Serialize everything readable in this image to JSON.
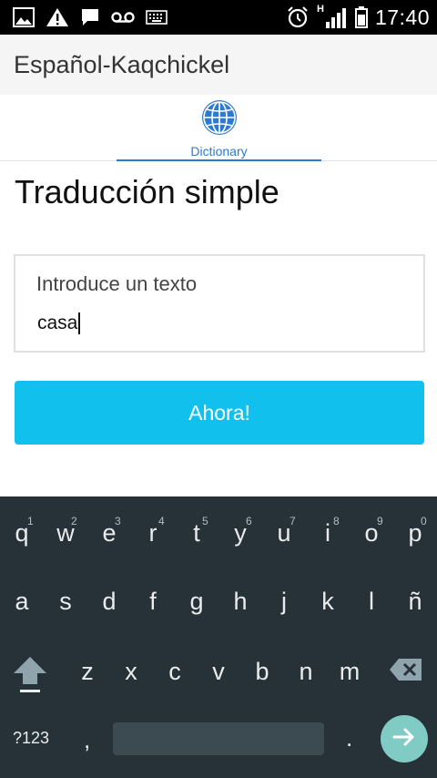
{
  "status_bar": {
    "time": "17:40",
    "network_type": "H",
    "left_icons": [
      "image-notification-icon",
      "warning-icon",
      "chat-bubble-icon",
      "voicemail-icon",
      "keyboard-icon"
    ],
    "right_icons": [
      "alarm-icon",
      "signal-icon",
      "battery-icon"
    ]
  },
  "app_bar": {
    "title": "Español-Kaqchickel"
  },
  "tabs": [
    {
      "label": "Dictionary",
      "icon": "globe-icon",
      "active": true
    }
  ],
  "main": {
    "title": "Traducción simple",
    "input": {
      "label": "Introduce un texto",
      "value": "casa"
    },
    "button_label": "Ahora!"
  },
  "colors": {
    "accent": "#2d7bd1",
    "button": "#12c0ee",
    "keyboard_bg": "#263238",
    "enter_key": "#80cbc4"
  },
  "keyboard": {
    "row1": [
      {
        "char": "q",
        "hint": "1"
      },
      {
        "char": "w",
        "hint": "2"
      },
      {
        "char": "e",
        "hint": "3"
      },
      {
        "char": "r",
        "hint": "4"
      },
      {
        "char": "t",
        "hint": "5"
      },
      {
        "char": "y",
        "hint": "6"
      },
      {
        "char": "u",
        "hint": "7"
      },
      {
        "char": "i",
        "hint": "8"
      },
      {
        "char": "o",
        "hint": "9"
      },
      {
        "char": "p",
        "hint": "0"
      }
    ],
    "row2": [
      "a",
      "s",
      "d",
      "f",
      "g",
      "h",
      "j",
      "k",
      "l",
      "ñ"
    ],
    "row3": [
      "z",
      "x",
      "c",
      "v",
      "b",
      "n",
      "m"
    ],
    "symbols_label": "?123",
    "comma": ",",
    "period": "."
  }
}
